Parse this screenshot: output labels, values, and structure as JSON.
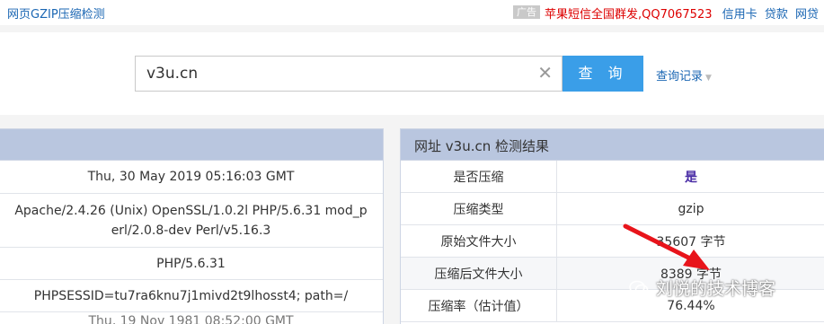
{
  "topbar": {
    "title": "网页GZIP压缩检测",
    "ad_tag": "广告",
    "ad_text": "苹果短信全国群发,QQ7067523",
    "links": [
      "信用卡",
      "贷款",
      "网贷"
    ]
  },
  "search": {
    "value": "v3u.cn",
    "clear_glyph": "✕",
    "button_label": "查 询",
    "history_label": "查询记录"
  },
  "left_panel": {
    "rows": [
      "Thu, 30 May 2019 05:16:03 GMT",
      "Apache/2.4.26 (Unix) OpenSSL/1.0.2l PHP/5.6.31 mod_perl/2.0.8-dev Perl/v5.16.3",
      "PHP/5.6.31",
      "PHPSESSID=tu7ra6knu7j1mivd2t9lhosst4; path=/",
      "Thu, 19 Nov 1981 08:52:00 GMT"
    ]
  },
  "result_panel": {
    "title": "网址 v3u.cn 检测结果",
    "rows": [
      {
        "label": "是否压缩",
        "value": "是"
      },
      {
        "label": "压缩类型",
        "value": "gzip"
      },
      {
        "label": "原始文件大小",
        "value": "35607 字节"
      },
      {
        "label": "压缩后文件大小",
        "value": "8389 字节"
      },
      {
        "label": "压缩率（估计值）",
        "value": "76.44%"
      }
    ]
  },
  "watermark": {
    "text": "刘悦的技术博客",
    "icon": "wechat-icon"
  },
  "colors": {
    "accent": "#3a9ee8",
    "link": "#1a66b3",
    "ad": "#dd0000",
    "header": "#b9c6df",
    "arrow": "#e8141b"
  }
}
